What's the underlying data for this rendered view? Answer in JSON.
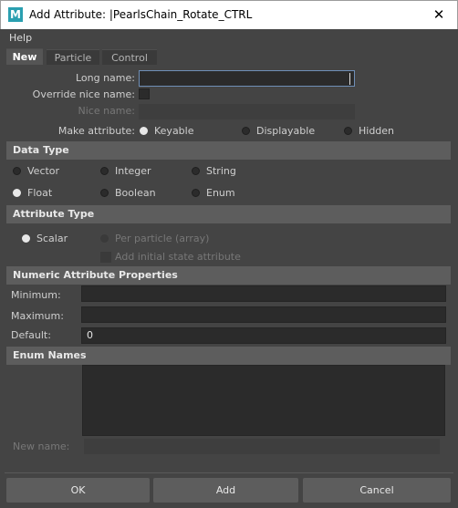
{
  "window": {
    "title": "Add Attribute: |PearlsChain_Rotate_CTRL",
    "icon_letter": "M",
    "close_glyph": "✕"
  },
  "menu": {
    "help": "Help"
  },
  "tabs": [
    {
      "label": "New",
      "active": true
    },
    {
      "label": "Particle",
      "active": false
    },
    {
      "label": "Control",
      "active": false
    }
  ],
  "fields": {
    "long_name_label": "Long name:",
    "long_name_value": "",
    "override_nice_name_label": "Override nice name:",
    "nice_name_label": "Nice name:",
    "nice_name_value": "",
    "make_attribute_label": "Make attribute:",
    "make_attribute_options": [
      "Keyable",
      "Displayable",
      "Hidden"
    ],
    "make_attribute_selected": "Keyable"
  },
  "data_type": {
    "title": "Data Type",
    "options": [
      "Vector",
      "Integer",
      "String",
      "Float",
      "Boolean",
      "Enum"
    ],
    "selected": "Float"
  },
  "attribute_type": {
    "title": "Attribute Type",
    "scalar": "Scalar",
    "per_particle": "Per particle (array)",
    "add_initial_state": "Add initial state attribute",
    "selected": "Scalar"
  },
  "numeric": {
    "title": "Numeric Attribute Properties",
    "minimum_label": "Minimum:",
    "minimum_value": "",
    "maximum_label": "Maximum:",
    "maximum_value": "",
    "default_label": "Default:",
    "default_value": "0"
  },
  "enum_names": {
    "title": "Enum Names",
    "new_name_label": "New name:",
    "new_name_value": ""
  },
  "buttons": {
    "ok": "OK",
    "add": "Add",
    "cancel": "Cancel"
  },
  "colors": {
    "background": "#444444",
    "section_header": "#5d5d5d",
    "field": "#2b2b2b",
    "focus_border": "#6f8fb7",
    "app_icon": "#2a9fb0"
  }
}
